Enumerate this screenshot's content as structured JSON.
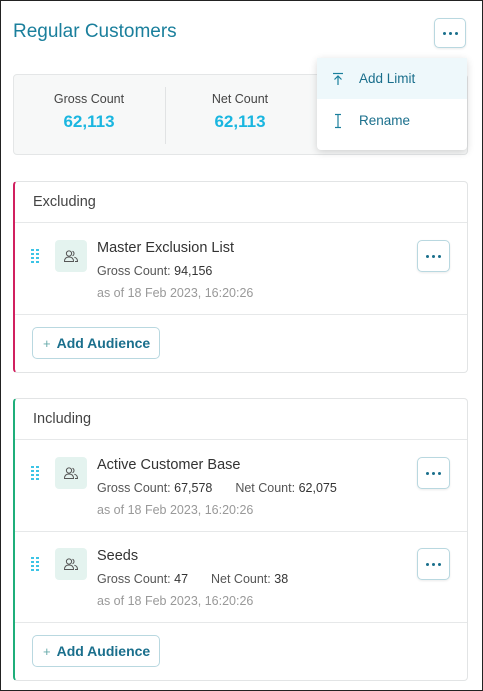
{
  "header": {
    "title": "Regular Customers"
  },
  "summary": {
    "stats": [
      {
        "label": "Gross Count",
        "value": "62,113"
      },
      {
        "label": "Net Count",
        "value": "62,113"
      }
    ]
  },
  "menu": {
    "items": [
      {
        "label": "Add Limit",
        "icon": "arrow-to-top-icon"
      },
      {
        "label": "Rename",
        "icon": "text-cursor-icon"
      }
    ]
  },
  "excluding": {
    "title": "Excluding",
    "items": [
      {
        "name": "Master Exclusion List",
        "gross_label": "Gross Count:",
        "gross_value": "94,156",
        "date": "as of 18 Feb 2023, 16:20:26"
      }
    ],
    "add_label": "Add Audience"
  },
  "including": {
    "title": "Including",
    "items": [
      {
        "name": "Active Customer Base",
        "gross_label": "Gross Count:",
        "gross_value": "67,578",
        "net_label": "Net Count:",
        "net_value": "62,075",
        "date": "as of 18 Feb 2023, 16:20:26"
      },
      {
        "name": "Seeds",
        "gross_label": "Gross Count:",
        "gross_value": "47",
        "net_label": "Net Count:",
        "net_value": "38",
        "date": "as of 18 Feb 2023, 16:20:26"
      }
    ],
    "add_label": "Add Audience"
  },
  "colors": {
    "title": "#1a7f9c",
    "count_value": "#1ab6e0",
    "excluding_accent": "#d1205f",
    "including_accent": "#1fae7a"
  }
}
